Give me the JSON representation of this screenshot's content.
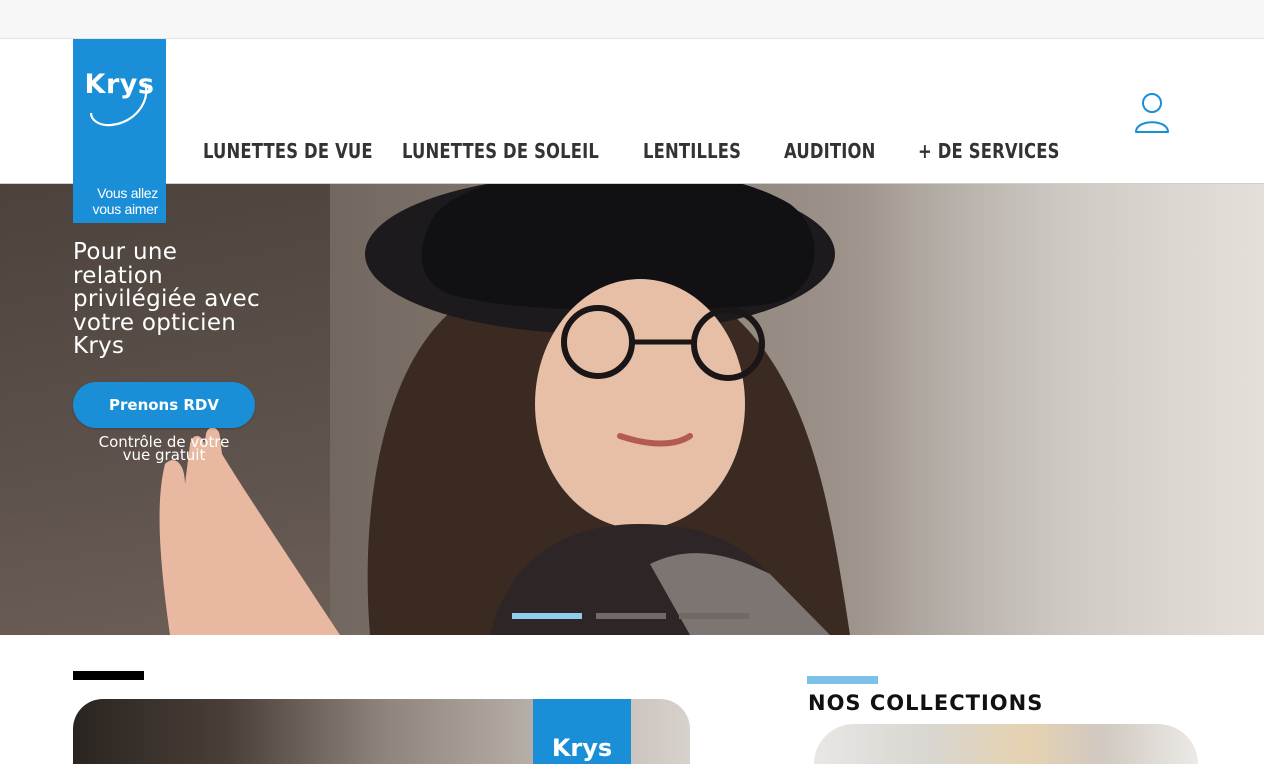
{
  "brand": {
    "name": "Krys",
    "tagline_line1": "Vous allez",
    "tagline_line2": "vous aimer",
    "color": "#1a8fd8"
  },
  "nav": {
    "items": [
      {
        "label": "LUNETTES DE VUE"
      },
      {
        "label": "LUNETTES DE SOLEIL"
      },
      {
        "label": "LENTILLES"
      },
      {
        "label": "AUDITION"
      },
      {
        "label": "+ DE SERVICES"
      }
    ],
    "account_icon": "user-icon"
  },
  "hero": {
    "title_lines": [
      "Pour une",
      "relation",
      "privilégiée avec",
      "votre opticien",
      "Krys"
    ],
    "cta_label": "Prenons RDV",
    "cta_sub_line1": "Contrôle de votre",
    "cta_sub_line2": "vue gratuit",
    "carousel": {
      "slides": 3,
      "active": 1,
      "active_color": "#8ecdf0",
      "inactive_color": "#6f6a66"
    }
  },
  "store": {
    "logo_text": "Krys"
  },
  "collections": {
    "title": "NOS COLLECTIONS",
    "accent": "#7ec1e8"
  }
}
